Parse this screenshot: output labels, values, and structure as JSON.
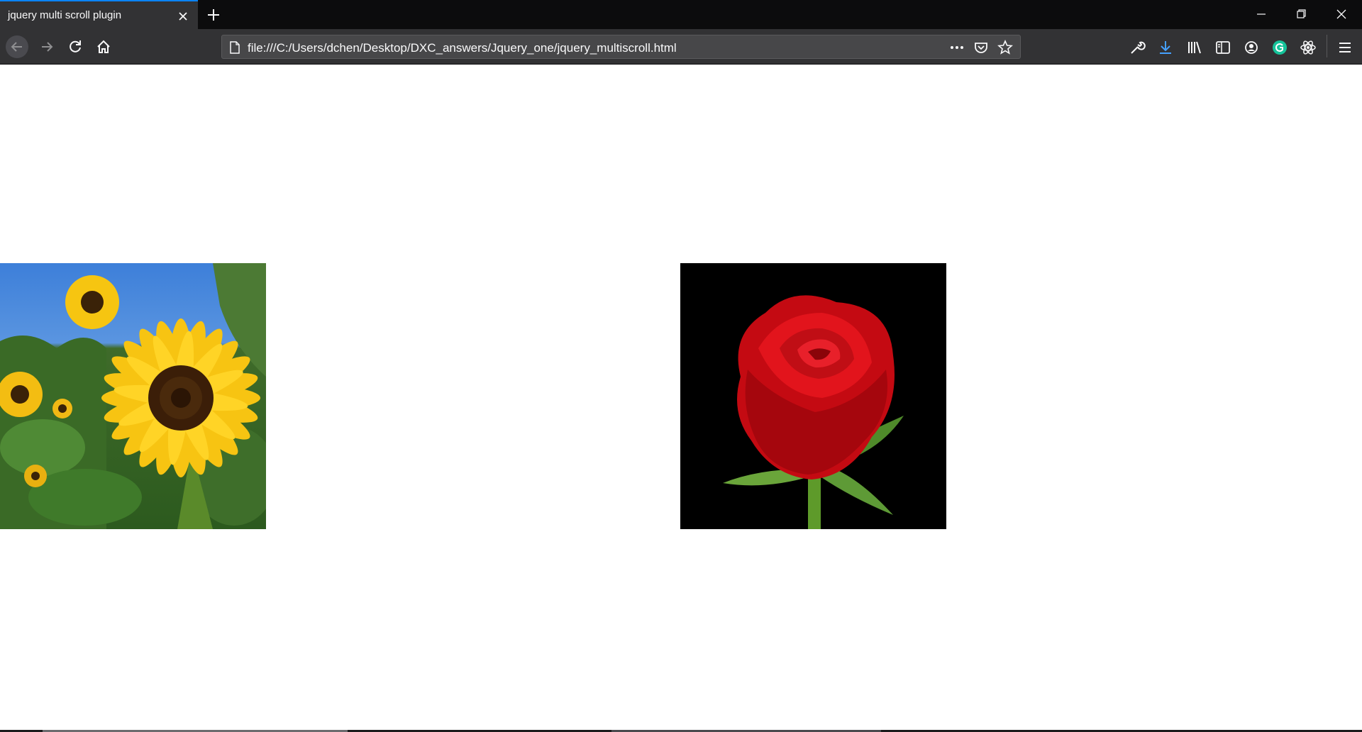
{
  "tab": {
    "title": "jquery multi scroll plugin"
  },
  "address_bar": {
    "url": "file:///C:/Users/dchen/Desktop/DXC_answers/Jquery_one/jquery_multiscroll.html"
  },
  "icons": {
    "back": "back-arrow-icon",
    "forward": "forward-arrow-icon",
    "reload": "reload-icon",
    "home": "home-icon",
    "page": "page-icon",
    "more": "ellipsis-icon",
    "pocket": "pocket-icon",
    "bookmark": "star-icon",
    "tools": "wrench-icon",
    "downloads": "download-icon",
    "library": "library-icon",
    "sidebar": "sidebar-icon",
    "account": "account-icon",
    "grammarly": "grammarly-icon",
    "react": "react-devtools-icon",
    "menu": "hamburger-menu-icon"
  },
  "colors": {
    "accent": "#0a84ff",
    "download": "#45a1ff",
    "grammarly": "#15c39a"
  },
  "images": [
    {
      "alt": "sunflower",
      "name": "sunflower-image"
    },
    {
      "alt": "red rose",
      "name": "rose-image"
    }
  ]
}
